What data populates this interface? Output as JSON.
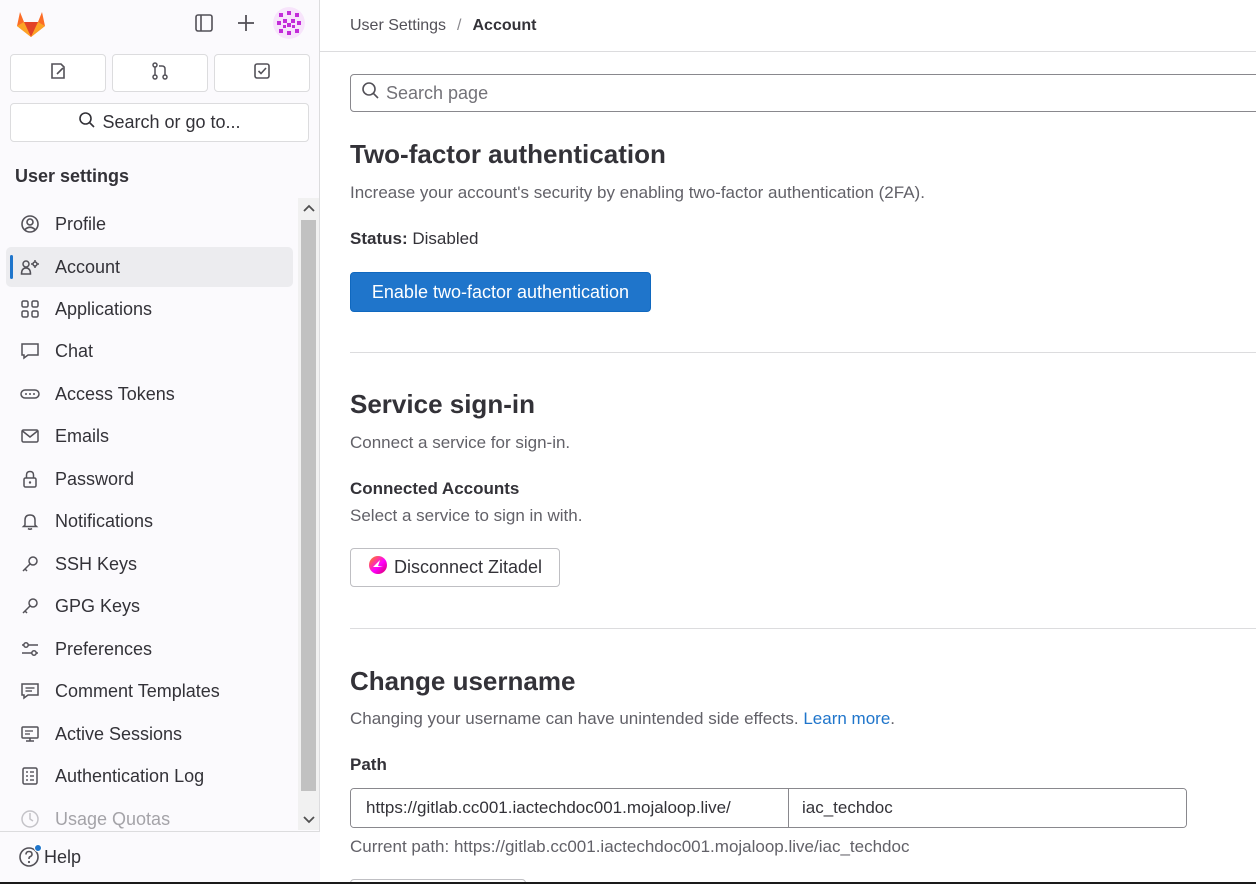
{
  "sidebar": {
    "heading": "User settings",
    "search_label": "Search or go to...",
    "items": [
      {
        "label": "Profile",
        "icon": "profile-icon",
        "active": false
      },
      {
        "label": "Account",
        "icon": "account-icon",
        "active": true
      },
      {
        "label": "Applications",
        "icon": "applications-icon",
        "active": false
      },
      {
        "label": "Chat",
        "icon": "chat-icon",
        "active": false
      },
      {
        "label": "Access Tokens",
        "icon": "token-icon",
        "active": false
      },
      {
        "label": "Emails",
        "icon": "mail-icon",
        "active": false
      },
      {
        "label": "Password",
        "icon": "lock-icon",
        "active": false
      },
      {
        "label": "Notifications",
        "icon": "bell-icon",
        "active": false
      },
      {
        "label": "SSH Keys",
        "icon": "key-icon",
        "active": false
      },
      {
        "label": "GPG Keys",
        "icon": "key-icon",
        "active": false
      },
      {
        "label": "Preferences",
        "icon": "preferences-icon",
        "active": false
      },
      {
        "label": "Comment Templates",
        "icon": "comment-icon",
        "active": false
      },
      {
        "label": "Active Sessions",
        "icon": "monitor-icon",
        "active": false
      },
      {
        "label": "Authentication Log",
        "icon": "log-icon",
        "active": false
      },
      {
        "label": "Usage Quotas",
        "icon": "quota-icon",
        "active": false
      }
    ],
    "help_label": "Help"
  },
  "breadcrumb": {
    "parent": "User Settings",
    "separator": "/",
    "current": "Account"
  },
  "search": {
    "placeholder": "Search page"
  },
  "two_factor": {
    "title": "Two-factor authentication",
    "description": "Increase your account's security by enabling two-factor authentication (2FA).",
    "status_label": "Status:",
    "status_value": "Disabled",
    "button_label": "Enable two-factor authentication"
  },
  "service_signin": {
    "title": "Service sign-in",
    "description": "Connect a service for sign-in.",
    "connected_heading": "Connected Accounts",
    "connected_desc": "Select a service to sign in with.",
    "disconnect_label": "Disconnect Zitadel"
  },
  "change_username": {
    "title": "Change username",
    "description": "Changing your username can have unintended side effects.",
    "learn_more": "Learn more",
    "learn_more_suffix": ".",
    "path_label": "Path",
    "path_prefix": "https://gitlab.cc001.iactechdoc001.mojaloop.live/",
    "username_value": "iac_techdoc",
    "current_path": "Current path: https://gitlab.cc001.iactechdoc001.mojaloop.live/iac_techdoc"
  },
  "colors": {
    "accent": "#1f75cb",
    "sidebar_bg": "#fbfafd",
    "active_item_bg": "#ececef"
  }
}
